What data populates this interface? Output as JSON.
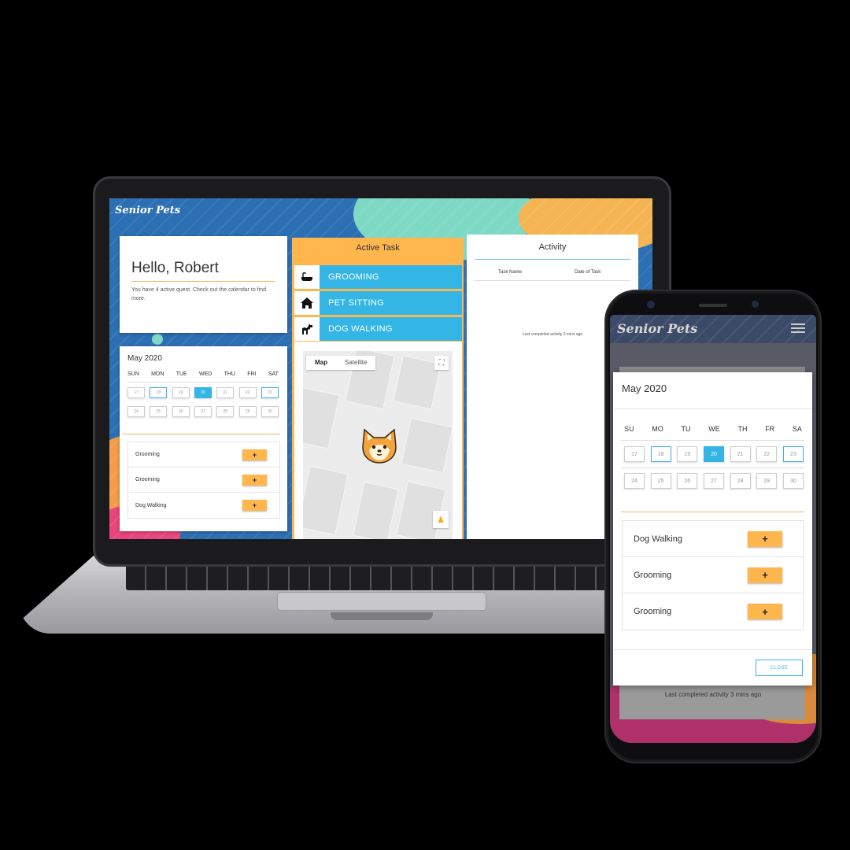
{
  "colors": {
    "accent_orange": "#ffb74d",
    "accent_blue": "#33b5e5",
    "card_bg": "#ffffff",
    "rule_orange": "#f0b76a"
  },
  "laptop": {
    "brand": "Senior Pets",
    "greeting": {
      "title": "Hello, Robert",
      "subtitle": "You have 4 active quest. Check out the calendar to find more."
    },
    "calendar": {
      "month": "May 2020",
      "weekdays": [
        "SUN",
        "MON",
        "TUE",
        "WED",
        "THU",
        "FRI",
        "SAT"
      ],
      "week1": [
        "17",
        "18",
        "19",
        "20",
        "21",
        "22",
        "23"
      ],
      "week2": [
        "24",
        "25",
        "26",
        "27",
        "28",
        "29",
        "30"
      ],
      "today": "20"
    },
    "services": [
      {
        "label": "Grooming",
        "button": "+"
      },
      {
        "label": "Grooming",
        "button": "+"
      },
      {
        "label": "Dog Walking",
        "button": "+"
      }
    ],
    "active_task": {
      "title": "Active Task",
      "tasks": [
        {
          "label": "GROOMING",
          "icon": "bathtub-icon"
        },
        {
          "label": "PET SITTING",
          "icon": "home-icon"
        },
        {
          "label": "DOG WALKING",
          "icon": "dog-icon"
        }
      ],
      "map": {
        "tab_map": "Map",
        "tab_satellite": "Satellite",
        "marker": "shiba-inu-avatar"
      }
    },
    "activity": {
      "title": "Activity",
      "col_task": "Task Name",
      "col_date": "Date of Task",
      "footer": "Last completed activity 3 mins ago"
    }
  },
  "phone": {
    "brand": "Senior Pets",
    "calendar": {
      "month": "May 2020",
      "weekdays": [
        "SU",
        "MO",
        "TU",
        "WE",
        "TH",
        "FR",
        "SA"
      ],
      "week1": [
        "17",
        "18",
        "19",
        "20",
        "21",
        "22",
        "23"
      ],
      "week2": [
        "24",
        "25",
        "26",
        "27",
        "28",
        "29",
        "30"
      ],
      "today": "20"
    },
    "services": [
      {
        "label": "Dog Walking",
        "button": "+"
      },
      {
        "label": "Grooming",
        "button": "+"
      },
      {
        "label": "Grooming",
        "button": "+"
      }
    ],
    "close_label": "CLOSE",
    "footer": "Last completed activity 3 mins ago"
  }
}
